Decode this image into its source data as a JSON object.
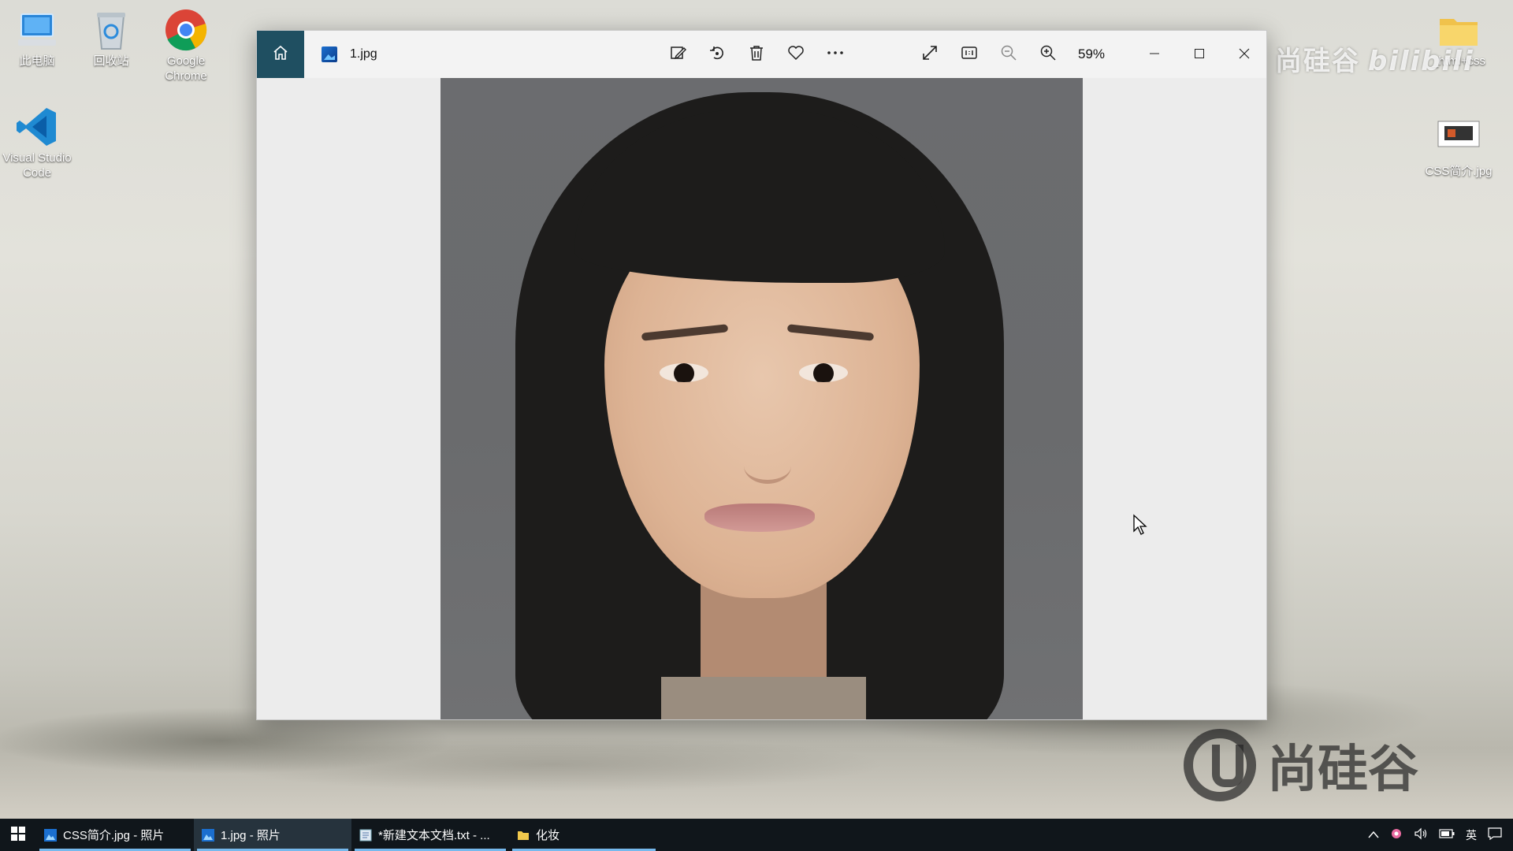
{
  "desktop": {
    "icons": [
      {
        "label": "此电脑",
        "icon": "computer-icon"
      },
      {
        "label": "回收站",
        "icon": "recycle-bin-icon"
      },
      {
        "label": "Google Chrome",
        "icon": "chrome-icon"
      },
      {
        "label": "Visual Studio Code",
        "icon": "vscode-icon"
      },
      {
        "label": "_html+css",
        "icon": "folder-icon"
      },
      {
        "label": "CSS简介.jpg",
        "icon": "image-file-icon"
      }
    ]
  },
  "watermark": {
    "top_text": "尚硅谷",
    "top_brand": "bilibili",
    "bottom_text": "尚硅谷"
  },
  "photos_window": {
    "file_name": "1.jpg",
    "zoom": "59%",
    "toolbar_icons": [
      "home-icon",
      "edit-icon",
      "rotate-icon",
      "delete-icon",
      "favorite-icon",
      "more-icon",
      "fullscreen-icon",
      "actual-size-icon",
      "zoom-out-icon",
      "zoom-in-icon"
    ],
    "window_controls": [
      "minimize-icon",
      "maximize-icon",
      "close-icon"
    ]
  },
  "taskbar": {
    "items": [
      {
        "label": "CSS简介.jpg - 照片",
        "icon": "photos-icon",
        "state": "open"
      },
      {
        "label": "1.jpg - 照片",
        "icon": "photos-icon",
        "state": "active"
      },
      {
        "label": "*新建文本文档.txt - ...",
        "icon": "notepad-icon",
        "state": "open"
      },
      {
        "label": "化妆",
        "icon": "folder-icon",
        "state": "open"
      }
    ],
    "tray": {
      "ime": "英"
    }
  },
  "colors": {
    "home_button": "#1f4f61",
    "taskbar": "#10161b",
    "taskbar_active": "#26333d",
    "taskbar_underline": "#76b9ed"
  }
}
